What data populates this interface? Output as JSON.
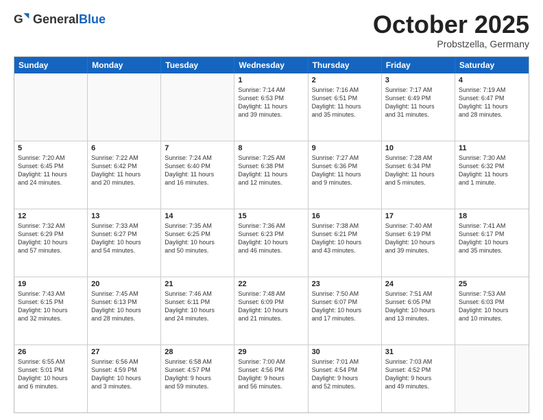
{
  "header": {
    "logo_general": "General",
    "logo_blue": "Blue",
    "month": "October 2025",
    "location": "Probstzella, Germany"
  },
  "days_of_week": [
    "Sunday",
    "Monday",
    "Tuesday",
    "Wednesday",
    "Thursday",
    "Friday",
    "Saturday"
  ],
  "weeks": [
    [
      {
        "day": "",
        "info": ""
      },
      {
        "day": "",
        "info": ""
      },
      {
        "day": "",
        "info": ""
      },
      {
        "day": "1",
        "info": "Sunrise: 7:14 AM\nSunset: 6:53 PM\nDaylight: 11 hours\nand 39 minutes."
      },
      {
        "day": "2",
        "info": "Sunrise: 7:16 AM\nSunset: 6:51 PM\nDaylight: 11 hours\nand 35 minutes."
      },
      {
        "day": "3",
        "info": "Sunrise: 7:17 AM\nSunset: 6:49 PM\nDaylight: 11 hours\nand 31 minutes."
      },
      {
        "day": "4",
        "info": "Sunrise: 7:19 AM\nSunset: 6:47 PM\nDaylight: 11 hours\nand 28 minutes."
      }
    ],
    [
      {
        "day": "5",
        "info": "Sunrise: 7:20 AM\nSunset: 6:45 PM\nDaylight: 11 hours\nand 24 minutes."
      },
      {
        "day": "6",
        "info": "Sunrise: 7:22 AM\nSunset: 6:42 PM\nDaylight: 11 hours\nand 20 minutes."
      },
      {
        "day": "7",
        "info": "Sunrise: 7:24 AM\nSunset: 6:40 PM\nDaylight: 11 hours\nand 16 minutes."
      },
      {
        "day": "8",
        "info": "Sunrise: 7:25 AM\nSunset: 6:38 PM\nDaylight: 11 hours\nand 12 minutes."
      },
      {
        "day": "9",
        "info": "Sunrise: 7:27 AM\nSunset: 6:36 PM\nDaylight: 11 hours\nand 9 minutes."
      },
      {
        "day": "10",
        "info": "Sunrise: 7:28 AM\nSunset: 6:34 PM\nDaylight: 11 hours\nand 5 minutes."
      },
      {
        "day": "11",
        "info": "Sunrise: 7:30 AM\nSunset: 6:32 PM\nDaylight: 11 hours\nand 1 minute."
      }
    ],
    [
      {
        "day": "12",
        "info": "Sunrise: 7:32 AM\nSunset: 6:29 PM\nDaylight: 10 hours\nand 57 minutes."
      },
      {
        "day": "13",
        "info": "Sunrise: 7:33 AM\nSunset: 6:27 PM\nDaylight: 10 hours\nand 54 minutes."
      },
      {
        "day": "14",
        "info": "Sunrise: 7:35 AM\nSunset: 6:25 PM\nDaylight: 10 hours\nand 50 minutes."
      },
      {
        "day": "15",
        "info": "Sunrise: 7:36 AM\nSunset: 6:23 PM\nDaylight: 10 hours\nand 46 minutes."
      },
      {
        "day": "16",
        "info": "Sunrise: 7:38 AM\nSunset: 6:21 PM\nDaylight: 10 hours\nand 43 minutes."
      },
      {
        "day": "17",
        "info": "Sunrise: 7:40 AM\nSunset: 6:19 PM\nDaylight: 10 hours\nand 39 minutes."
      },
      {
        "day": "18",
        "info": "Sunrise: 7:41 AM\nSunset: 6:17 PM\nDaylight: 10 hours\nand 35 minutes."
      }
    ],
    [
      {
        "day": "19",
        "info": "Sunrise: 7:43 AM\nSunset: 6:15 PM\nDaylight: 10 hours\nand 32 minutes."
      },
      {
        "day": "20",
        "info": "Sunrise: 7:45 AM\nSunset: 6:13 PM\nDaylight: 10 hours\nand 28 minutes."
      },
      {
        "day": "21",
        "info": "Sunrise: 7:46 AM\nSunset: 6:11 PM\nDaylight: 10 hours\nand 24 minutes."
      },
      {
        "day": "22",
        "info": "Sunrise: 7:48 AM\nSunset: 6:09 PM\nDaylight: 10 hours\nand 21 minutes."
      },
      {
        "day": "23",
        "info": "Sunrise: 7:50 AM\nSunset: 6:07 PM\nDaylight: 10 hours\nand 17 minutes."
      },
      {
        "day": "24",
        "info": "Sunrise: 7:51 AM\nSunset: 6:05 PM\nDaylight: 10 hours\nand 13 minutes."
      },
      {
        "day": "25",
        "info": "Sunrise: 7:53 AM\nSunset: 6:03 PM\nDaylight: 10 hours\nand 10 minutes."
      }
    ],
    [
      {
        "day": "26",
        "info": "Sunrise: 6:55 AM\nSunset: 5:01 PM\nDaylight: 10 hours\nand 6 minutes."
      },
      {
        "day": "27",
        "info": "Sunrise: 6:56 AM\nSunset: 4:59 PM\nDaylight: 10 hours\nand 3 minutes."
      },
      {
        "day": "28",
        "info": "Sunrise: 6:58 AM\nSunset: 4:57 PM\nDaylight: 9 hours\nand 59 minutes."
      },
      {
        "day": "29",
        "info": "Sunrise: 7:00 AM\nSunset: 4:56 PM\nDaylight: 9 hours\nand 56 minutes."
      },
      {
        "day": "30",
        "info": "Sunrise: 7:01 AM\nSunset: 4:54 PM\nDaylight: 9 hours\nand 52 minutes."
      },
      {
        "day": "31",
        "info": "Sunrise: 7:03 AM\nSunset: 4:52 PM\nDaylight: 9 hours\nand 49 minutes."
      },
      {
        "day": "",
        "info": ""
      }
    ]
  ]
}
